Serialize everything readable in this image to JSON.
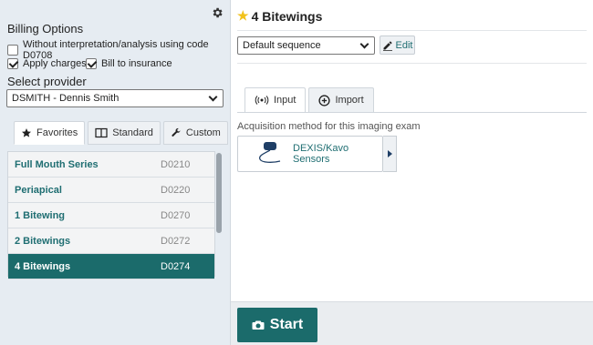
{
  "billing": {
    "title": "Billing Options",
    "without_interpretation": {
      "label": "Without interpretation/analysis using code D0708",
      "checked": false
    },
    "apply_charges": {
      "label": "Apply charges",
      "checked": true
    },
    "bill_to_insurance": {
      "label": "Bill to insurance",
      "checked": true
    }
  },
  "provider": {
    "title": "Select provider",
    "selected": "DSMITH - Dennis Smith"
  },
  "procedure_tabs": [
    {
      "label": "Favorites",
      "icon": "star-icon",
      "active": true
    },
    {
      "label": "Standard",
      "icon": "book-icon",
      "active": false
    },
    {
      "label": "Custom",
      "icon": "wrench-icon",
      "active": false
    }
  ],
  "procedures": [
    {
      "name": "Full Mouth Series",
      "code": "D0210",
      "selected": false
    },
    {
      "name": "Periapical",
      "code": "D0220",
      "selected": false
    },
    {
      "name": "1 Bitewing",
      "code": "D0270",
      "selected": false
    },
    {
      "name": "2 Bitewings",
      "code": "D0272",
      "selected": false
    },
    {
      "name": "4 Bitewings",
      "code": "D0274",
      "selected": true
    }
  ],
  "detail": {
    "title": "4 Bitewings",
    "sequence_selected": "Default sequence",
    "edit_label": "Edit",
    "tabs": [
      {
        "label": "Input",
        "icon": "radio-wave-icon",
        "active": true
      },
      {
        "label": "Import",
        "icon": "plus-circle-icon",
        "active": false
      }
    ],
    "acquisition_label": "Acquisition method for this imaging exam",
    "sensor_label": "DEXIS/Kavo Sensors",
    "start_label": "Start"
  },
  "colors": {
    "accent": "#1b6b6b",
    "link_text": "#1f6e72",
    "star": "#f2c21b"
  }
}
